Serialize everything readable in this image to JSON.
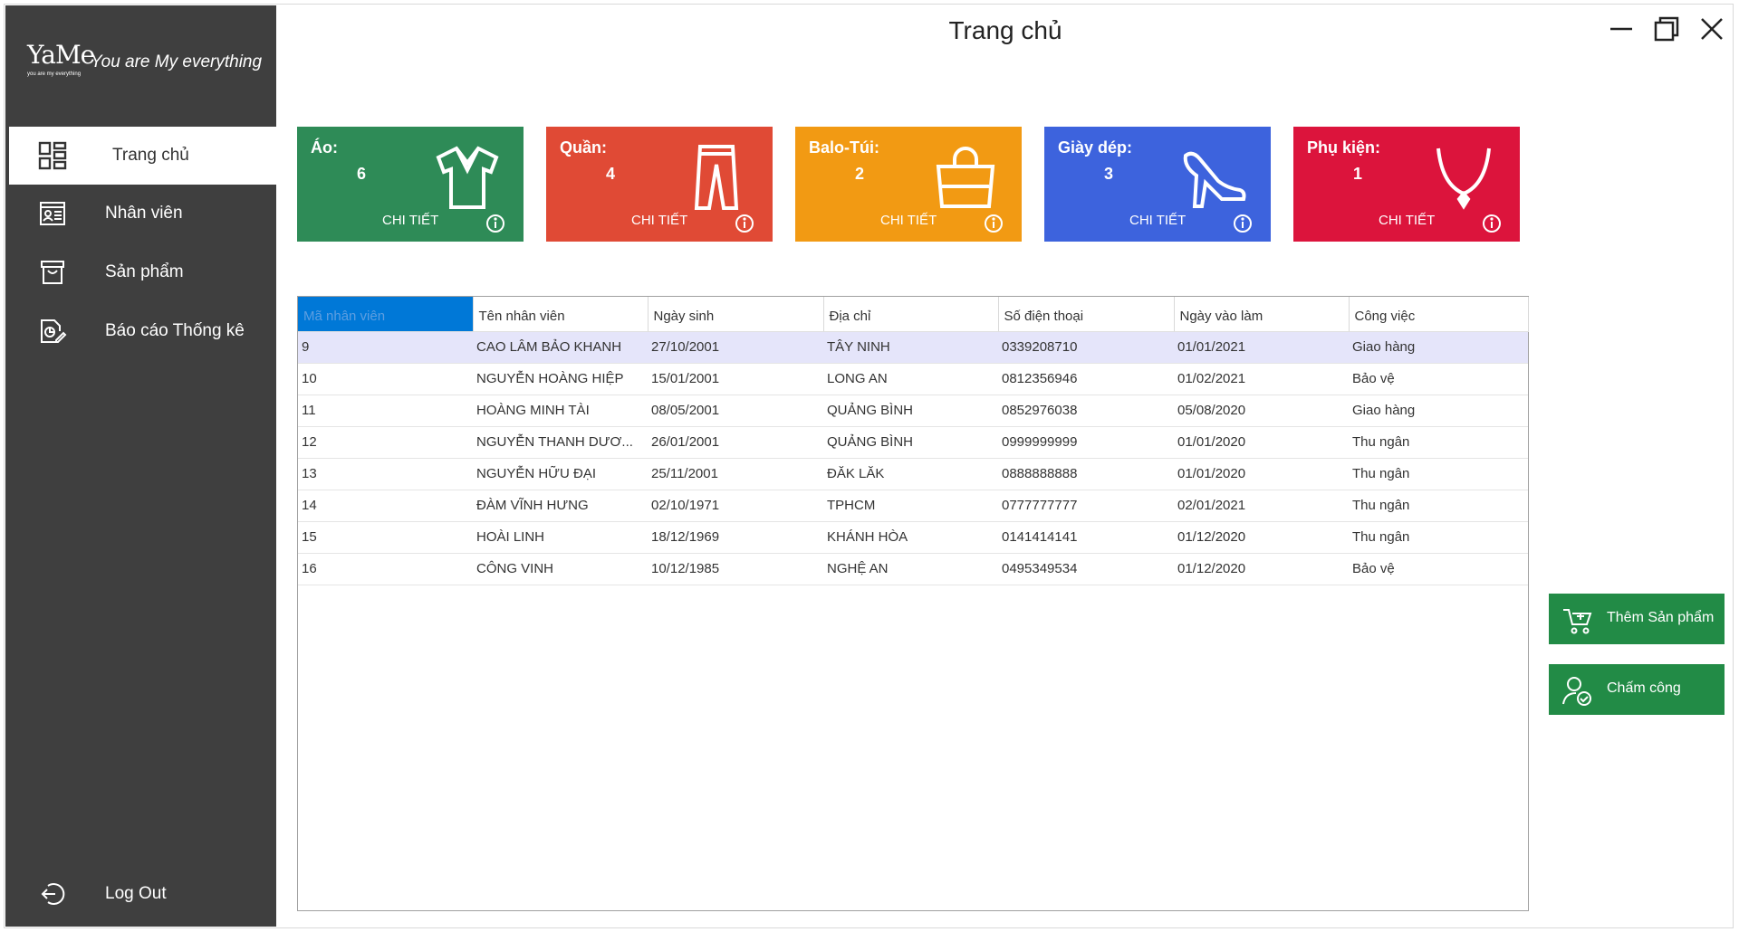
{
  "window": {
    "title": "Trang chủ"
  },
  "brand": {
    "logo_text": "YaMe",
    "logo_subtext": "you are my everything",
    "slogan": "You are My everything"
  },
  "sidebar": {
    "items": [
      {
        "label": "Trang chủ",
        "icon": "dashboard-icon",
        "active": true
      },
      {
        "label": "Nhân viên",
        "icon": "employee-card-icon"
      },
      {
        "label": "Sản phẩm",
        "icon": "product-box-icon"
      },
      {
        "label": "Báo cáo Thống kê",
        "icon": "report-icon"
      }
    ],
    "logout_label": "Log Out"
  },
  "categories": [
    {
      "name": "Áo:",
      "count": "6",
      "detail": "CHI TIẾT",
      "color": "#2e8b57",
      "icon": "shirt-icon"
    },
    {
      "name": "Quần:",
      "count": "4",
      "detail": "CHI TIẾT",
      "color": "#e04a35",
      "icon": "pants-icon"
    },
    {
      "name": "Balo-Túi:",
      "count": "2",
      "detail": "CHI TIẾT",
      "color": "#f29a13",
      "icon": "handbag-icon"
    },
    {
      "name": "Giày dép:",
      "count": "3",
      "detail": "CHI TIẾT",
      "color": "#3d63dd",
      "icon": "high-heel-icon"
    },
    {
      "name": "Phụ kiện:",
      "count": "1",
      "detail": "CHI TIẾT",
      "color": "#dc143c",
      "icon": "necklace-icon"
    }
  ],
  "table": {
    "columns": [
      "Mã nhân viên",
      "Tên nhân viên",
      "Ngày sinh",
      "Địa chỉ",
      "Số điện thoại",
      "Ngày vào làm",
      "Công việc"
    ],
    "rows": [
      [
        "9",
        "CAO LÂM BẢO KHANH",
        "27/10/2001",
        "TÂY NINH",
        "0339208710",
        "01/01/2021",
        "Giao hàng"
      ],
      [
        "10",
        "NGUYỄN HOÀNG HIỆP",
        "15/01/2001",
        "LONG AN",
        "0812356946",
        "01/02/2021",
        "Bảo vệ"
      ],
      [
        "11",
        "HOÀNG MINH TÀI",
        "08/05/2001",
        "QUẢNG BÌNH",
        "0852976038",
        "05/08/2020",
        "Giao hàng"
      ],
      [
        "12",
        "NGUYỄN THANH DƯƠ...",
        "26/01/2001",
        "QUẢNG BÌNH",
        "0999999999",
        "01/01/2020",
        "Thu ngân"
      ],
      [
        "13",
        "NGUYỄN HỮU ĐẠI",
        "25/11/2001",
        "ĐĂK LĂK",
        "0888888888",
        "01/01/2020",
        "Thu ngân"
      ],
      [
        "14",
        "ĐÀM VĨNH HƯNG",
        "02/10/1971",
        "TPHCM",
        "0777777777",
        "02/01/2021",
        "Thu ngân"
      ],
      [
        "15",
        "HOÀI LINH",
        "18/12/1969",
        "KHÁNH HÒA",
        "0141414141",
        "01/12/2020",
        "Thu ngân"
      ],
      [
        "16",
        "CÔNG VINH",
        "10/12/1985",
        "NGHỆ AN",
        "0495349534",
        "01/12/2020",
        "Bảo vệ"
      ]
    ],
    "selected_row": 0
  },
  "actions": {
    "add_product_label": "Thêm Sản phẩm",
    "attendance_label": "Chấm công"
  },
  "colors": {
    "sidebar_bg": "#3f3f3f",
    "action_green": "#228b46",
    "header_selected": "#0078d7",
    "row_selected": "#e5e5fa"
  }
}
